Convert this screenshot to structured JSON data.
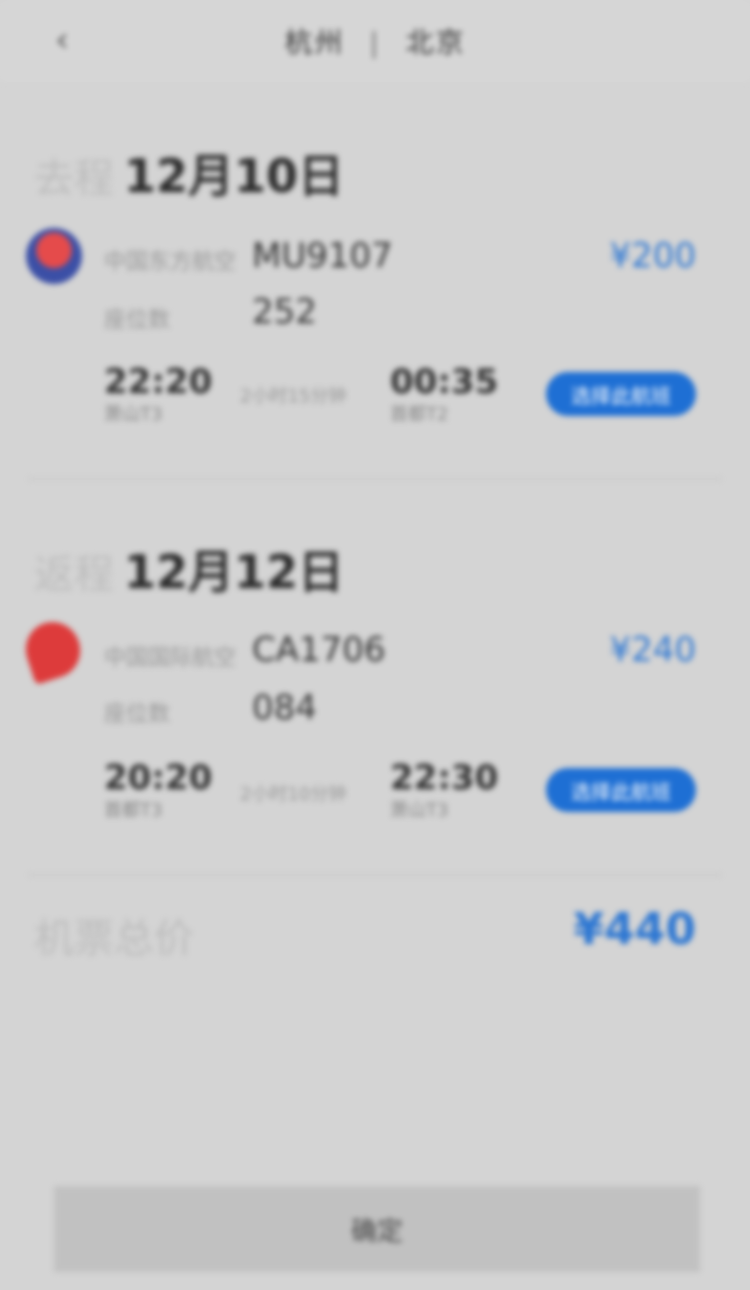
{
  "header": {
    "back_icon": "chevron-left-icon",
    "origin": "杭州",
    "separator": "|",
    "destination": "北京"
  },
  "outbound": {
    "trip_label": "去程",
    "date": "12月10日",
    "airline_logo": "china-eastern-logo",
    "flight_label": "中国东方航空",
    "flight_no": "MU9107",
    "seat_label": "座位数",
    "seat_count": "252",
    "price": "¥200",
    "depart_time": "22:20",
    "depart_airport": "萧山T3",
    "duration": "2小时15分钟",
    "arrive_time": "00:35",
    "arrive_airport": "首都T2",
    "select_label": "选择此航班"
  },
  "return": {
    "trip_label": "返程",
    "date": "12月12日",
    "airline_logo": "air-china-logo",
    "flight_label": "中国国际航空",
    "flight_no": "CA1706",
    "seat_label": "座位数",
    "seat_count": "084",
    "price": "¥240",
    "depart_time": "20:20",
    "depart_airport": "首都T3",
    "duration": "2小时10分钟",
    "arrive_time": "22:30",
    "arrive_airport": "萧山T3",
    "select_label": "选择此航班"
  },
  "total": {
    "label": "机票总价",
    "price": "¥440"
  },
  "confirm_label": "确定",
  "colors": {
    "accent": "#2c76d2",
    "button": "#1e6fd4",
    "background": "#d4d4d4"
  }
}
